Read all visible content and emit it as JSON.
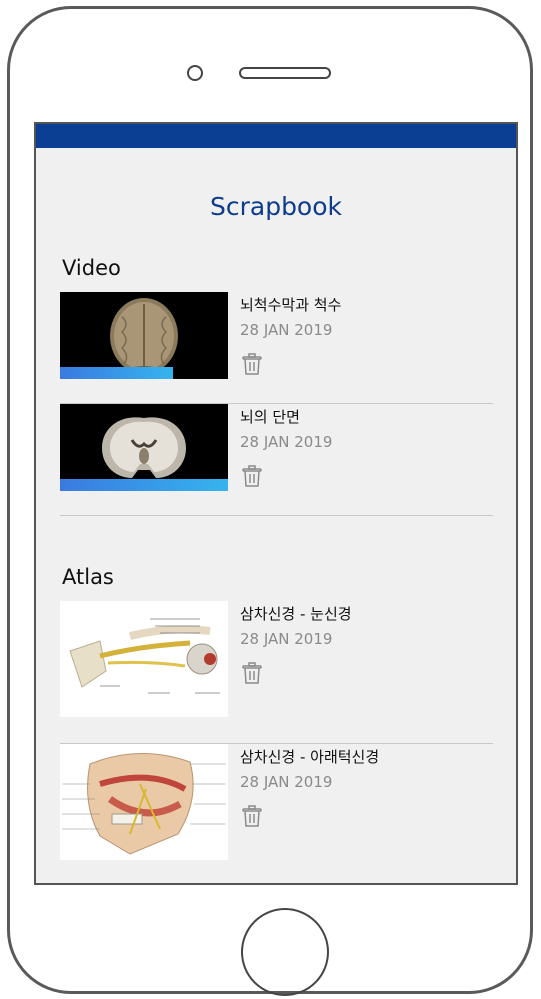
{
  "app": {
    "title": "Scrapbook"
  },
  "colors": {
    "status_bar": "#0b3f94",
    "title": "#0d3c8e",
    "progress_start": "#3a7ae0",
    "progress_end": "#35b4ee"
  },
  "sections": {
    "video": {
      "title": "Video",
      "items": [
        {
          "title": "뇌척수막과 척수",
          "date": "28 JAN 2019",
          "thumbnail": "brain-top-view",
          "progress": 0.67
        },
        {
          "title": "뇌의 단면",
          "date": "28 JAN 2019",
          "thumbnail": "brain-coronal-section",
          "progress": 1.0
        }
      ]
    },
    "atlas": {
      "title": "Atlas",
      "items": [
        {
          "title": "삼차신경 - 눈신경",
          "date": "28 JAN 2019",
          "thumbnail": "ophthalmic-nerve-illustration"
        },
        {
          "title": "삼차신경 - 아래턱신경",
          "date": "28 JAN 2019",
          "thumbnail": "mandibular-nerve-illustration"
        }
      ]
    }
  },
  "icons": {
    "delete": "trash-icon"
  }
}
